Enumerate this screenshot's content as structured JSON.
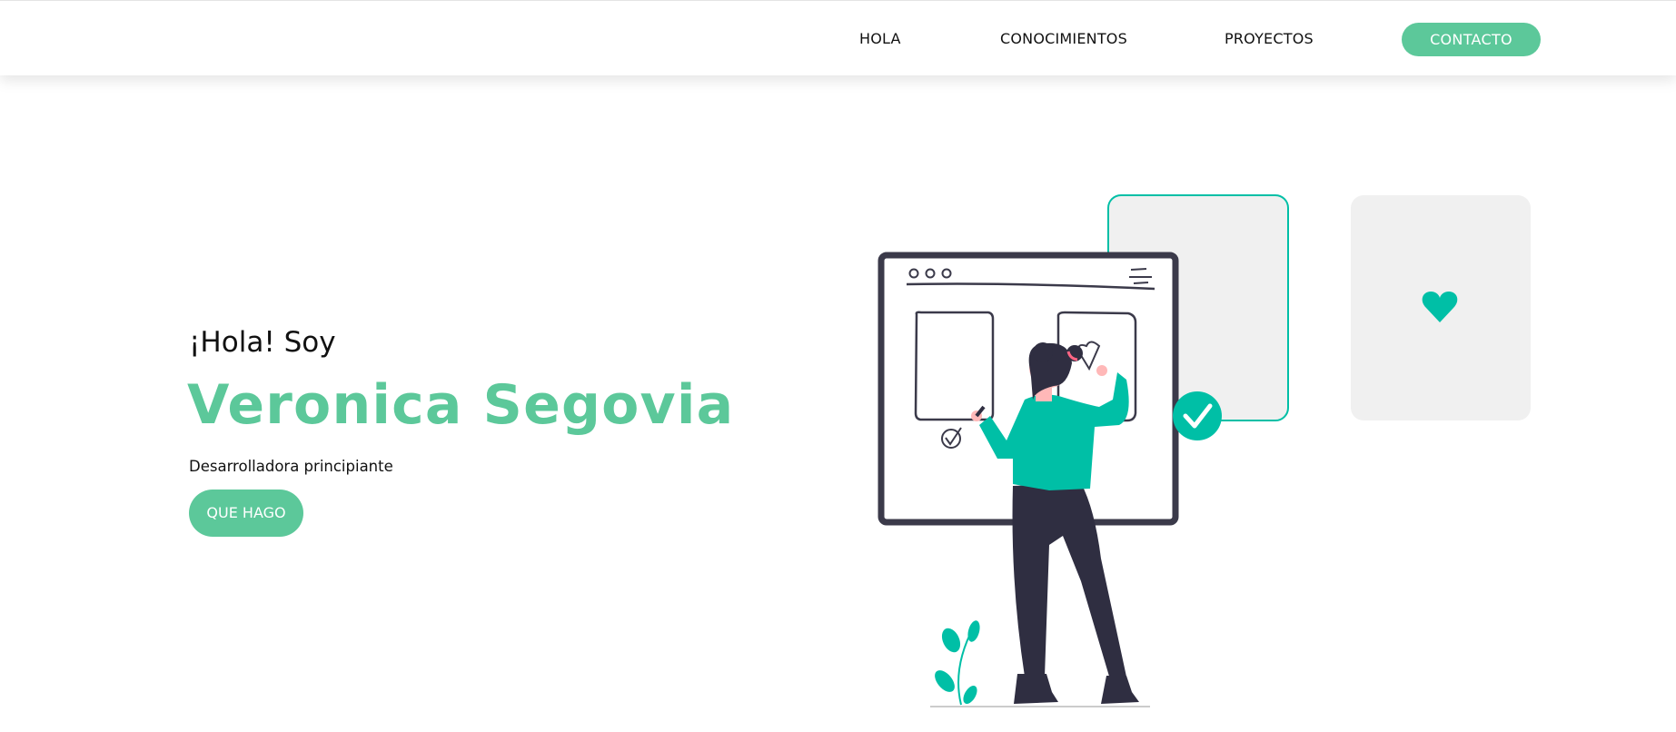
{
  "navbar": {
    "links": [
      {
        "label": "HOLA"
      },
      {
        "label": "CONOCIMIENTOS"
      },
      {
        "label": "PROYECTOS"
      }
    ],
    "contact_label": "CONTACTO"
  },
  "hero": {
    "greeting": "¡Hola! Soy",
    "name": "Veronica Segovia",
    "subtitle": "Desarrolladora principiante",
    "cta_label": "QUE HAGO"
  },
  "colors": {
    "accent": "#5cc89a",
    "illustration_accent": "#00bfa6",
    "dark": "#2f2e41",
    "card_bg": "#f0f0f0"
  }
}
